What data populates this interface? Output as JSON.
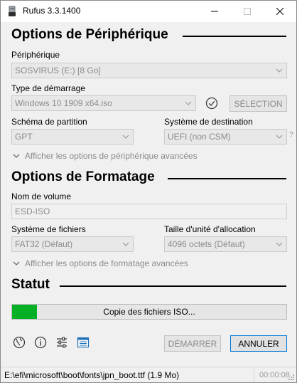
{
  "window": {
    "title": "Rufus 3.3.1400"
  },
  "device_options": {
    "heading": "Options de Périphérique",
    "device_label": "Périphérique",
    "device_value": "SOSVIRUS (E:) [8 Go]",
    "boot_type_label": "Type de démarrage",
    "boot_type_value": "Windows 10 1909 x64.iso",
    "select_button": "SÉLECTION",
    "partition_label": "Schéma de partition",
    "partition_value": "GPT",
    "target_label": "Système de destination",
    "target_value": "UEFI (non CSM)",
    "help_mark": "?",
    "advanced_toggle": "Afficher les options de périphérique avancées"
  },
  "format_options": {
    "heading": "Options de Formatage",
    "volume_label": "Nom de volume",
    "volume_value": "ESD-ISO",
    "filesystem_label": "Système de fichiers",
    "filesystem_value": "FAT32 (Défaut)",
    "cluster_label": "Taille d'unité d'allocation",
    "cluster_value": "4096 octets (Défaut)",
    "advanced_toggle": "Afficher les options de formatage avancées"
  },
  "status": {
    "heading": "Statut",
    "progress_text": "Copie des fichiers ISO...",
    "progress_fraction": 0.09
  },
  "buttons": {
    "start": "DÉMARRER",
    "cancel": "ANNULER"
  },
  "statusbar": {
    "path": "E:\\efi\\microsoft\\boot\\fonts\\jpn_boot.ttf (1.9 Mo)",
    "elapsed": "00:00:08"
  },
  "colors": {
    "progress_fill": "#06b025",
    "accent_border": "#0078d7",
    "disabled_text": "#8c8c8c"
  },
  "icons": [
    "rufus-usb-icon",
    "language-globe-icon",
    "info-icon",
    "settings-sliders-icon",
    "log-icon",
    "check-hash-icon"
  ]
}
